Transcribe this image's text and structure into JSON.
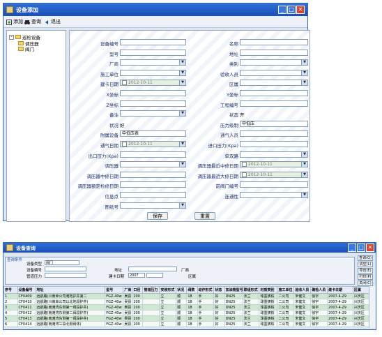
{
  "top_window": {
    "title": "设备添加",
    "controls": [
      "_",
      "□",
      "✕"
    ],
    "toolbar": {
      "add": "添加",
      "query": "查询",
      "back": "退出"
    },
    "tree": {
      "root": "巡检设备",
      "children": [
        "调压器",
        "阀门"
      ]
    },
    "left_fields": [
      {
        "label": "设备编号",
        "value": "",
        "type": "text"
      },
      {
        "label": "型号",
        "value": "",
        "type": "text"
      },
      {
        "label": "厂商",
        "value": "",
        "type": "select"
      },
      {
        "label": "施工单位",
        "value": "",
        "type": "select"
      },
      {
        "label": "建卡日期",
        "value": "2012-10-11",
        "type": "date"
      },
      {
        "label": "X坐标",
        "value": "",
        "type": "text"
      },
      {
        "label": "Z坐标",
        "value": "",
        "type": "text"
      },
      {
        "label": "备注",
        "value": "",
        "type": "select"
      },
      {
        "label": "状况",
        "value": "好",
        "type": "plain"
      },
      {
        "label": "附属设备",
        "value": "中低压表",
        "type": "text"
      },
      {
        "label": "通气日期",
        "value": "2012-10-11",
        "type": "date"
      },
      {
        "label": "出口压力(Kpa)",
        "value": "",
        "type": "text"
      },
      {
        "label": "调压器",
        "value": "",
        "type": "select"
      },
      {
        "label": "调压器中修日期",
        "value": "",
        "type": "text"
      },
      {
        "label": "调压器额定检修日期",
        "value": "",
        "type": "text"
      },
      {
        "label": "信息点",
        "value": "",
        "type": "text"
      },
      {
        "label": "图纸号",
        "value": "",
        "type": "select"
      }
    ],
    "right_fields": [
      {
        "label": "名称",
        "value": "",
        "type": "text"
      },
      {
        "label": "地址",
        "value": "",
        "type": "text"
      },
      {
        "label": "类别",
        "value": "",
        "type": "select"
      },
      {
        "label": "验收人员",
        "value": "",
        "type": "select"
      },
      {
        "label": "区属",
        "value": "",
        "type": "select"
      },
      {
        "label": "Y坐标",
        "value": "",
        "type": "text"
      },
      {
        "label": "工程编号",
        "value": "",
        "type": "text"
      },
      {
        "label": "状态",
        "value": "开",
        "type": "plain"
      },
      {
        "label": "压力级制",
        "value": "中低压",
        "type": "text"
      },
      {
        "label": "通气人员",
        "value": "",
        "type": "text"
      },
      {
        "label": "进口压力(Kpa)",
        "value": "",
        "type": "text"
      },
      {
        "label": "单双路",
        "value": "",
        "type": "select"
      },
      {
        "label": "调压器最近中修日期",
        "value": "2012-10-11",
        "type": "date"
      },
      {
        "label": "调压器最近大修日期",
        "value": "2012-10-11",
        "type": "date"
      },
      {
        "label": "前阀门编号",
        "value": "",
        "type": "text"
      },
      {
        "label": "连通性",
        "value": "",
        "type": "select"
      }
    ],
    "buttons": {
      "save": "保存",
      "reset": "重置"
    }
  },
  "bottom_window": {
    "title": "设备查询",
    "controls": [
      "_",
      "□",
      "✕"
    ],
    "filter": {
      "legend": "查询条件",
      "device_type_label": "设备类型",
      "device_type_value": "阀门",
      "device_no_label": "设备编号",
      "address_label": "地址",
      "manufacturer_label": "厂商",
      "pipe_pressure_label": "管道压力",
      "card_date_label": "建卡日期",
      "card_date_from": "2007",
      "district_label": "区属"
    },
    "side_buttons": [
      "查询(Q)",
      "清空(L)",
      "导出(E)",
      "打印(P)",
      "关闭(C)"
    ],
    "columns": [
      "序号",
      "设备编号",
      "地址",
      "型号",
      "厂商",
      "口径",
      "管道压力",
      "安装形式",
      "状况",
      "阀数",
      "动作形式",
      "状态",
      "加油管型号",
      "联组形式",
      "材质类别",
      "施工单位",
      "验收人员",
      "确检人员",
      "建卡日期",
      "区属"
    ],
    "rows": [
      [
        "1",
        "CF0409",
        "远航路(川南幸公司滩地护井第二",
        "FGZ-40w",
        "吴县",
        "200",
        "",
        "立",
        "顺",
        "18",
        "手",
        "好",
        "DN25",
        "法兰",
        "球墨铸铁",
        "二公司",
        "宋健文",
        "徐宇",
        "2007-4-29",
        "兴庆区"
      ],
      [
        "2",
        "CF0410",
        "远航路(川南幸公司以北地段护井)",
        "FGZ-40w",
        "吴县",
        "200",
        "",
        "立",
        "顺",
        "18",
        "手",
        "好",
        "DN25",
        "法兰",
        "球墨铸铁",
        "二公司",
        "宋健文",
        "徐宇",
        "2007-4-29",
        "兴庆区"
      ],
      [
        "3",
        "CF0411",
        "远航路(南滩湾东侧第一阀段护井)",
        "FGZ-40w",
        "吴县",
        "200",
        "",
        "立",
        "顺",
        "18",
        "手",
        "好",
        "DN25",
        "法兰",
        "球墨铸铁",
        "二公司",
        "宋健文",
        "徐宇",
        "2007-4-29",
        "兴庆区"
      ],
      [
        "4",
        "CF0412",
        "远航路(南滩湾东侧第二阀段护井)",
        "FGZ-40w",
        "吴县",
        "200",
        "",
        "立",
        "顺",
        "18",
        "手",
        "好",
        "DN25",
        "法兰",
        "球墨铸铁",
        "二公司",
        "宋健文",
        "徐宇",
        "2007-4-29",
        "兴庆区"
      ],
      [
        "5",
        "CF0413",
        "远航路(南滩湾东侧第一阀段护井)",
        "FGZ-40w",
        "吴县",
        "200",
        "",
        "立",
        "顺",
        "18",
        "手",
        "好",
        "DN25",
        "法兰",
        "球墨铸铁",
        "二公司",
        "宋健文",
        "徐宇",
        "2007-4-29",
        "兴庆区"
      ],
      [
        "6",
        "CF0414",
        "远航路(南滩湾三段北侧阀体)",
        "FGZ-40w",
        "吴县",
        "200",
        "",
        "立",
        "顺",
        "18",
        "手",
        "好",
        "DN25",
        "法兰",
        "球墨铸铁",
        "二公司",
        "宋健文",
        "徐宇",
        "2007-4-29",
        "兴庆区"
      ]
    ]
  }
}
